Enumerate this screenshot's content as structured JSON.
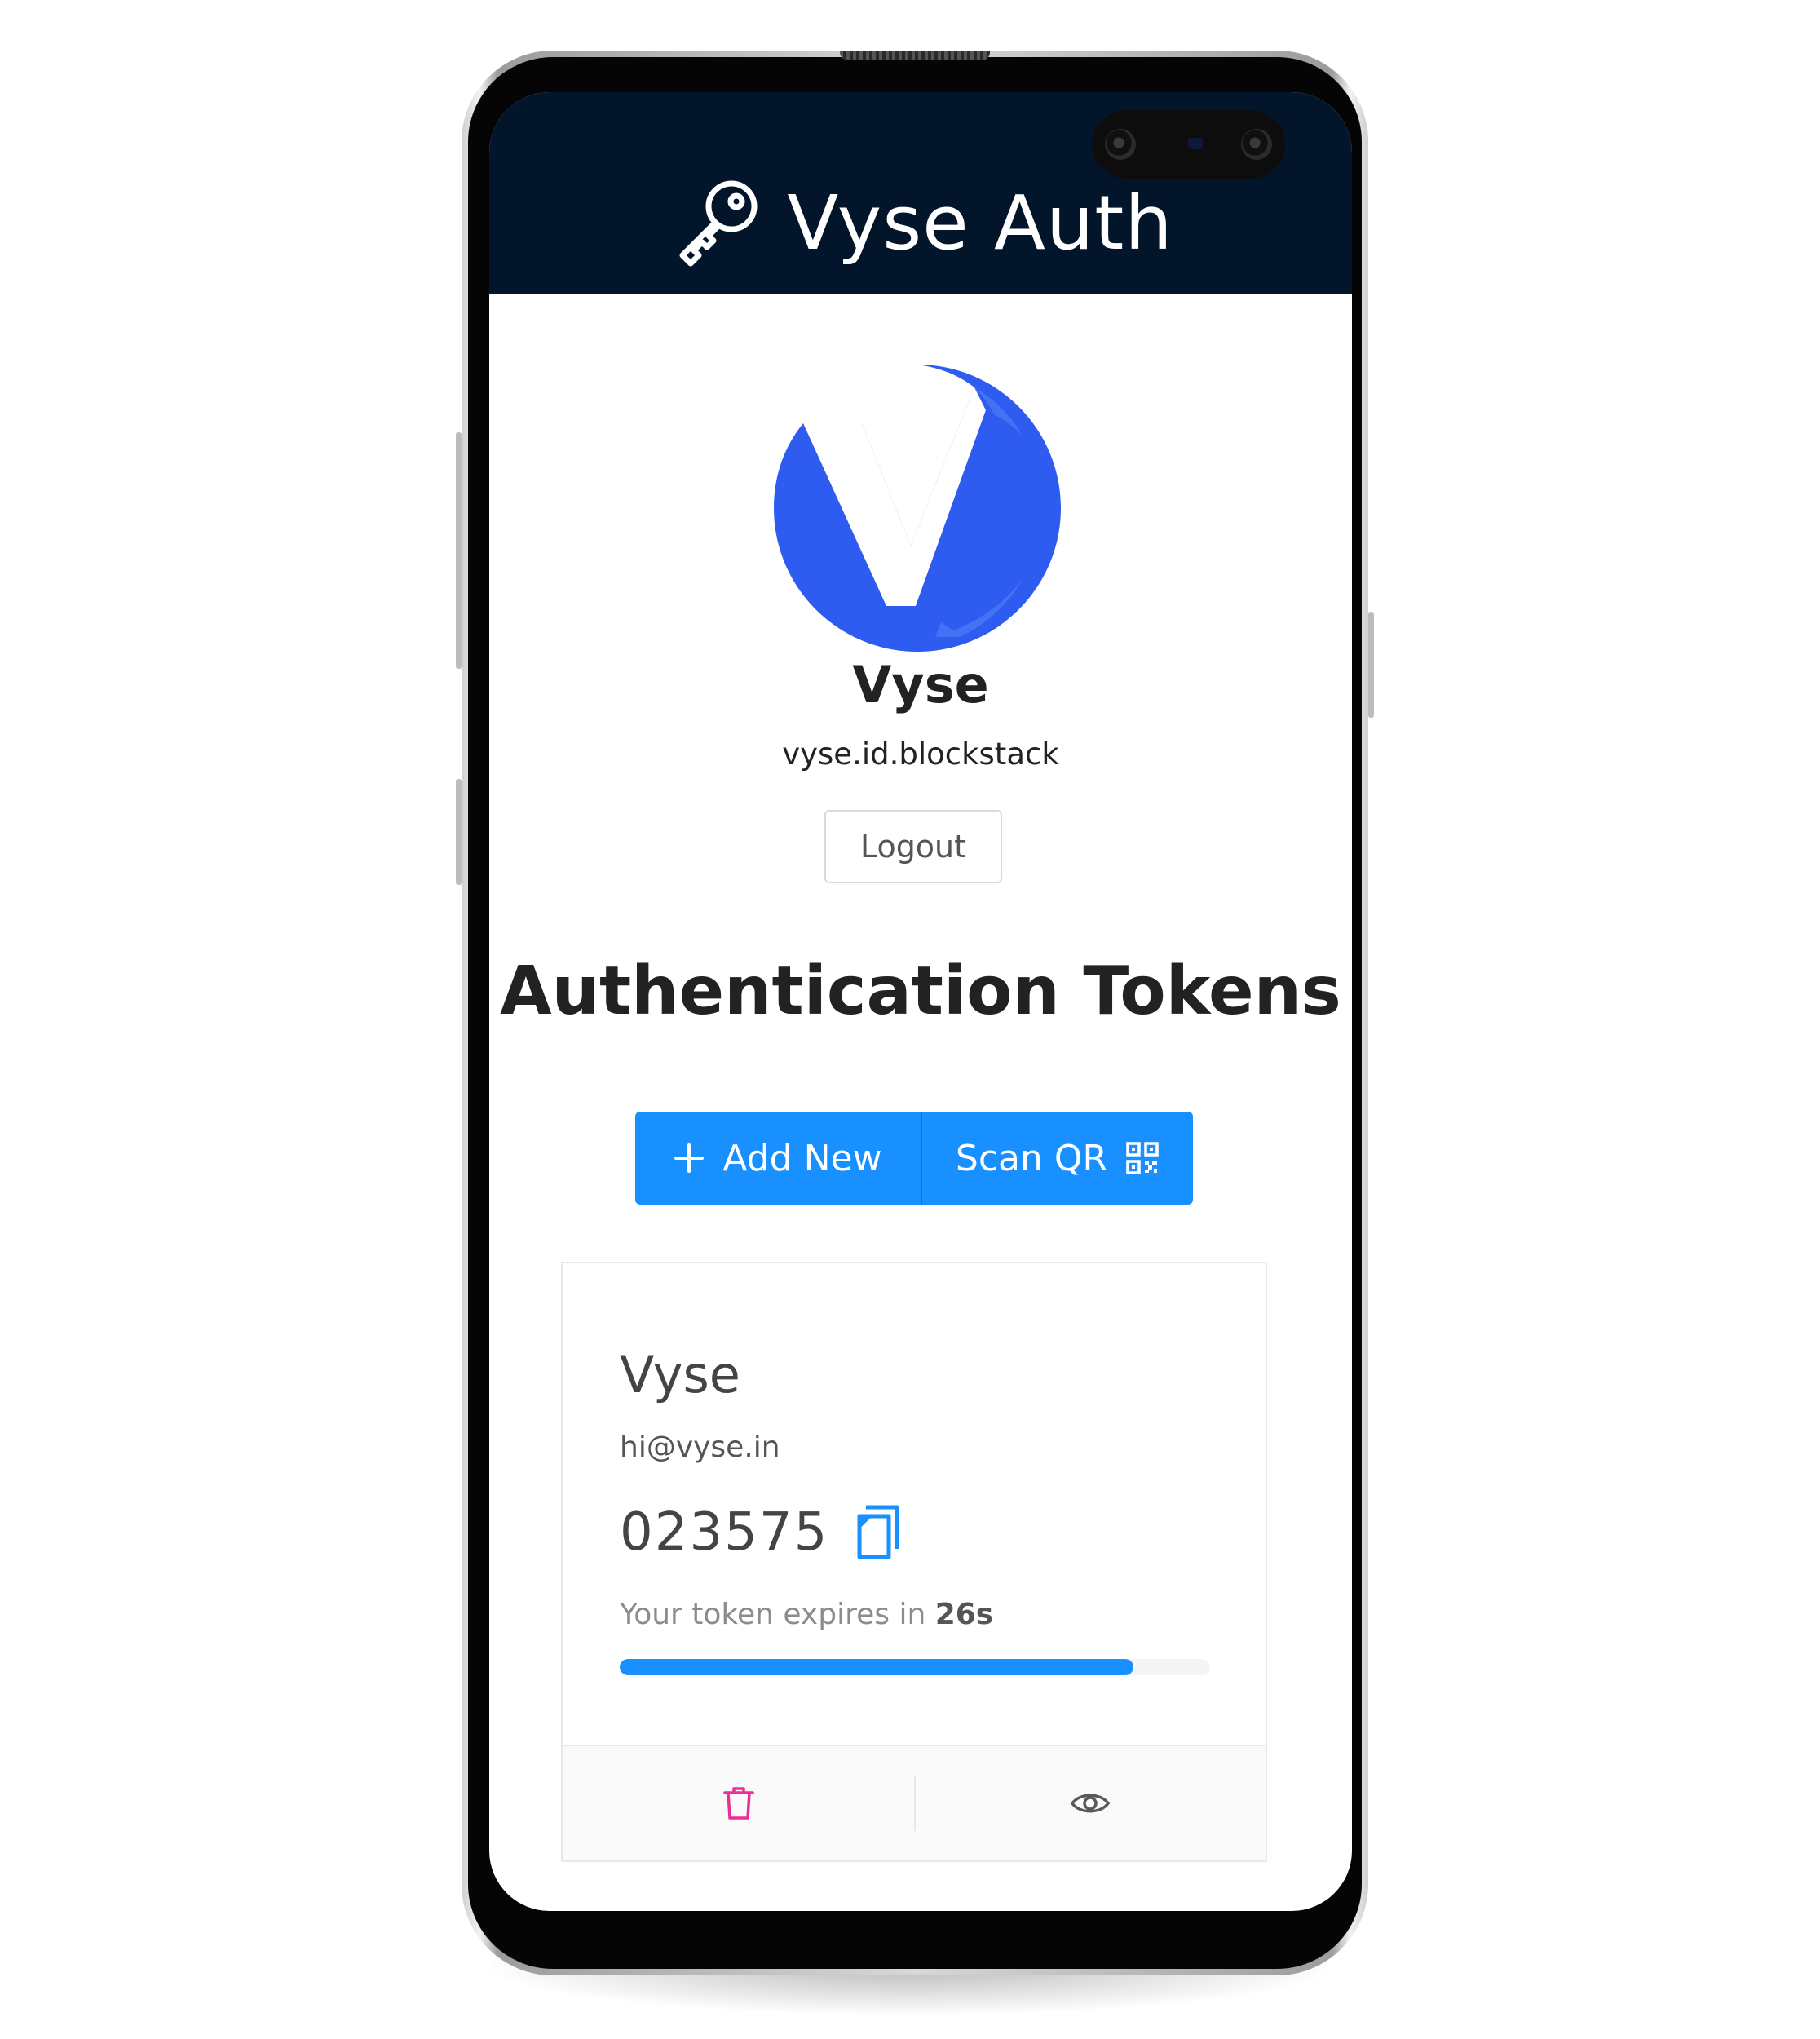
{
  "app": {
    "title": "Vyse Auth"
  },
  "profile": {
    "name": "Vyse",
    "id": "vyse.id.blockstack",
    "logout_label": "Logout"
  },
  "tokens": {
    "heading": "Authentication Tokens",
    "add_label": "Add New",
    "scan_label": "Scan QR",
    "items": [
      {
        "name": "Vyse",
        "account": "hi@vyse.in",
        "code": "023575",
        "expiry_prefix": "Your token expires in ",
        "expiry_value": "26s",
        "progress_fraction": 0.87
      }
    ]
  },
  "colors": {
    "appbar": "#02152b",
    "primary": "#1890ff",
    "brand_blue": "#2f5cf0",
    "delete": "#eb2f96"
  },
  "icons": {
    "brand": "key-icon",
    "add": "plus-icon",
    "scan": "qr-code-icon",
    "copy": "copy-icon",
    "delete": "trash-icon",
    "view": "eye-icon"
  }
}
